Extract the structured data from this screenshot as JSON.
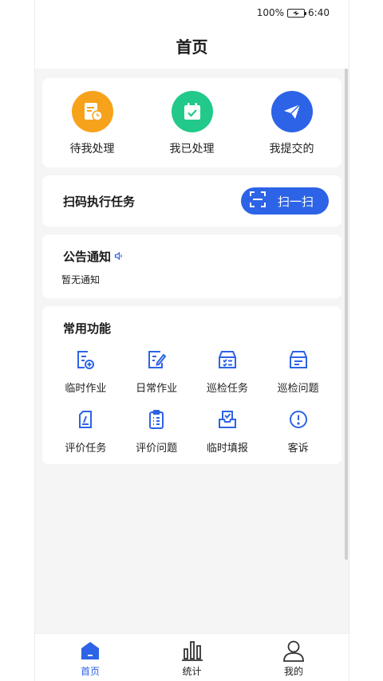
{
  "status": {
    "battery": "100%",
    "time": "6:40"
  },
  "header": {
    "title": "首页"
  },
  "quick_actions": [
    {
      "label": "待我处理",
      "icon": "pending-doc-icon",
      "color": "#f7a21b"
    },
    {
      "label": "我已处理",
      "icon": "calendar-check-icon",
      "color": "#22c98a"
    },
    {
      "label": "我提交的",
      "icon": "paper-plane-icon",
      "color": "#2d63e6"
    }
  ],
  "scan": {
    "title": "扫码执行任务",
    "button_label": "扫一扫"
  },
  "notice": {
    "title": "公告通知",
    "text": "暂无通知"
  },
  "common": {
    "title": "常用功能",
    "items": [
      {
        "label": "临时作业"
      },
      {
        "label": "日常作业"
      },
      {
        "label": "巡检任务"
      },
      {
        "label": "巡检问题"
      },
      {
        "label": "评价任务"
      },
      {
        "label": "评价问题"
      },
      {
        "label": "临时填报"
      },
      {
        "label": "客诉"
      }
    ]
  },
  "tabs": [
    {
      "label": "首页",
      "active": true
    },
    {
      "label": "统计",
      "active": false
    },
    {
      "label": "我的",
      "active": false
    }
  ],
  "colors": {
    "accent": "#2d63e6",
    "orange": "#f7a21b",
    "green": "#22c98a"
  }
}
